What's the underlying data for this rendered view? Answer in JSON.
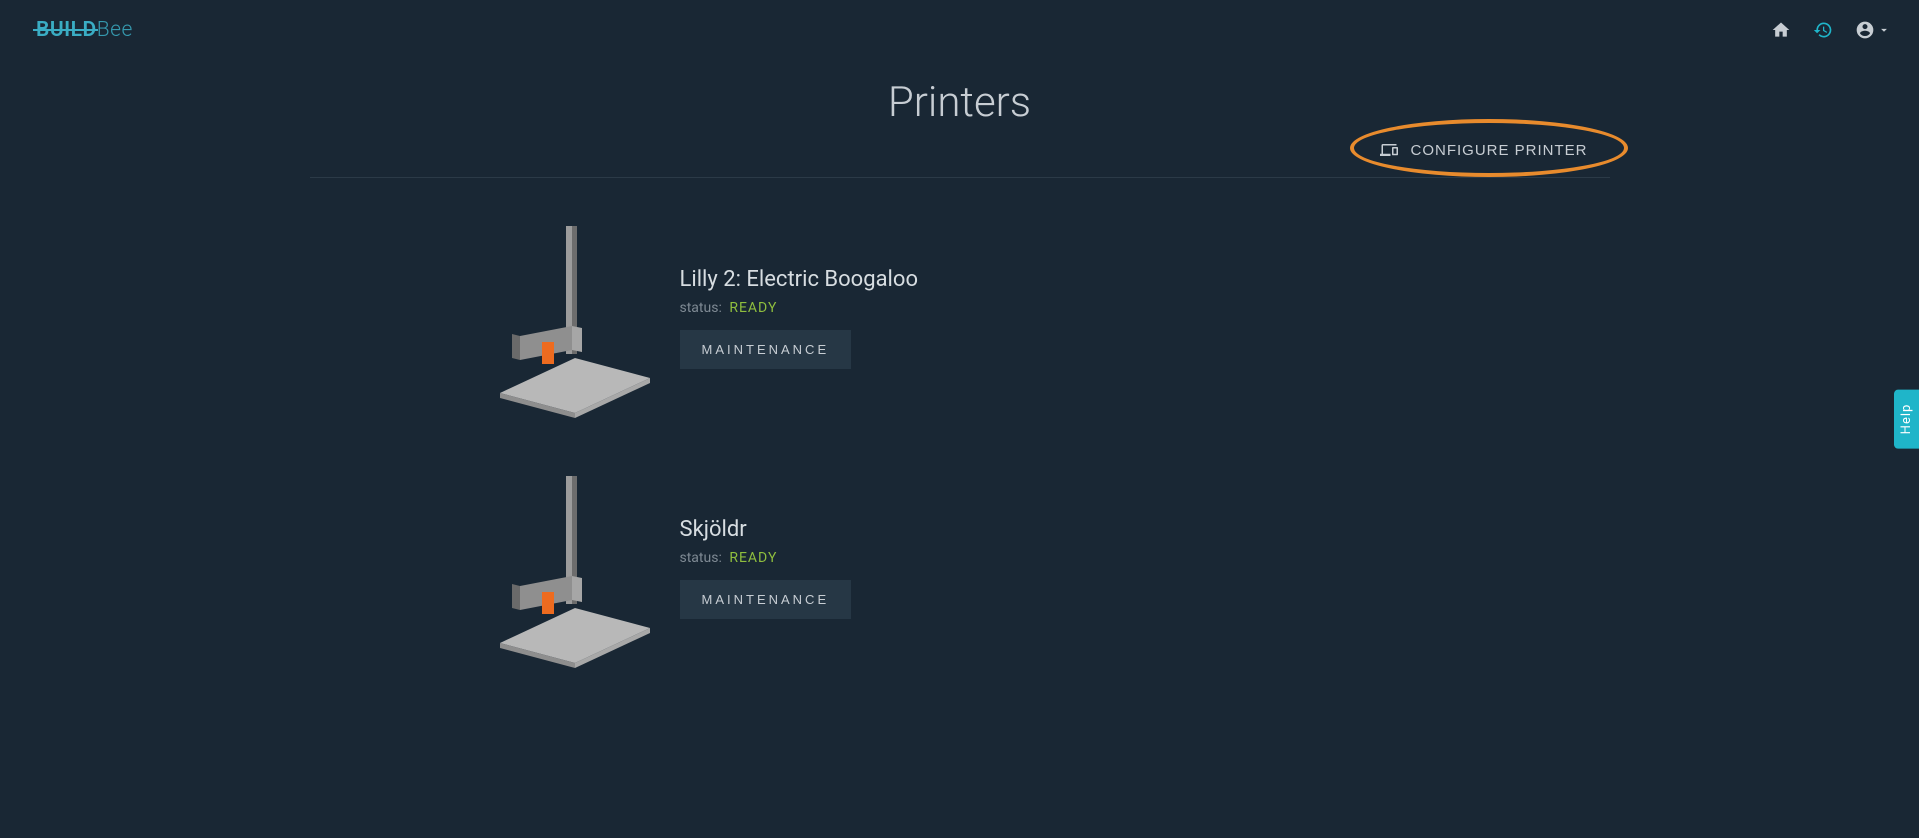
{
  "brand": {
    "part1": "BUILD",
    "part2": "Bee"
  },
  "page": {
    "title": "Printers"
  },
  "toolbar": {
    "configure_label": "CONFIGURE PRINTER"
  },
  "status_label": "status:",
  "maintenance_label": "MAINTENANCE",
  "help_label": "Help",
  "printers": [
    {
      "name": "Lilly 2: Electric Boogaloo",
      "status": "READY"
    },
    {
      "name": "Skjöldr",
      "status": "READY"
    }
  ]
}
